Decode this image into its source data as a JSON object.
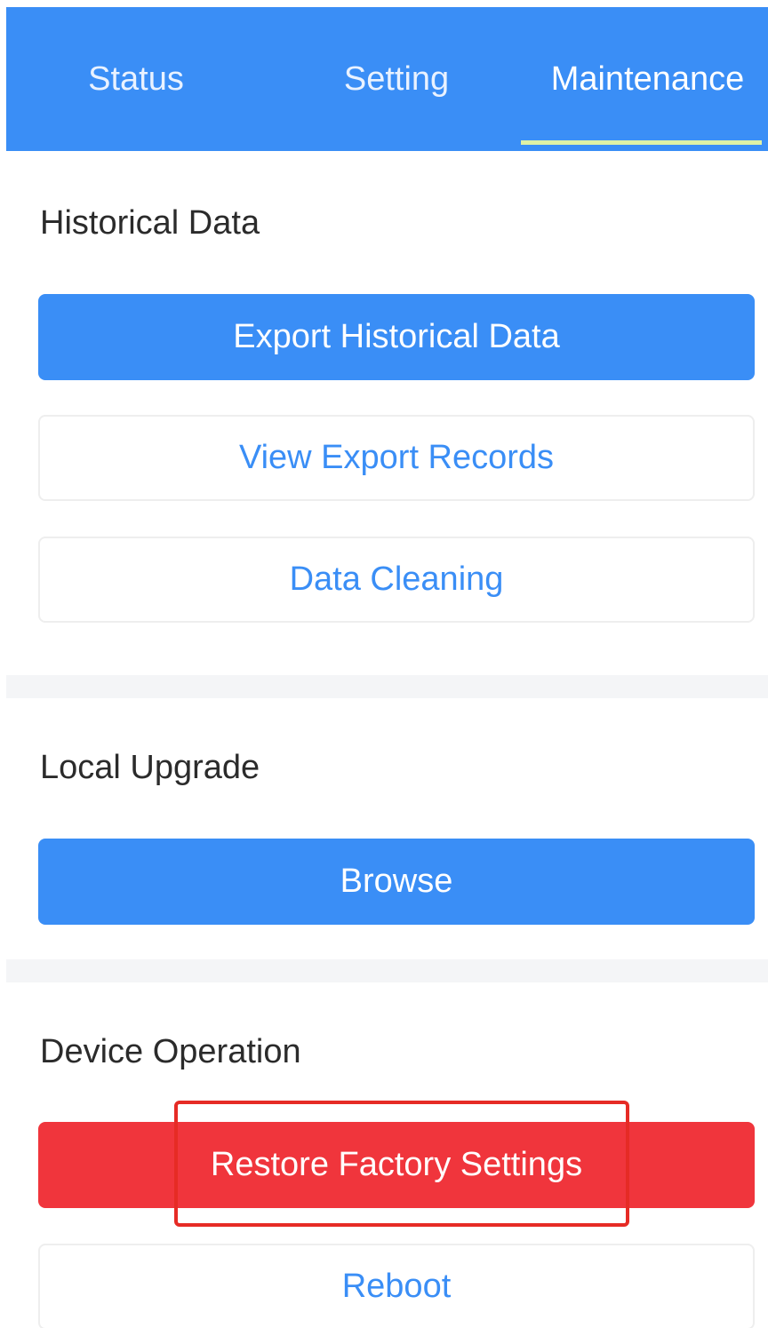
{
  "tabs": {
    "status": "Status",
    "setting": "Setting",
    "maintenance": "Maintenance",
    "active": "maintenance"
  },
  "historical_data": {
    "title": "Historical Data",
    "export_label": "Export Historical Data",
    "view_records_label": "View Export Records",
    "cleaning_label": "Data Cleaning"
  },
  "local_upgrade": {
    "title": "Local Upgrade",
    "browse_label": "Browse"
  },
  "device_operation": {
    "title": "Device Operation",
    "restore_label": "Restore Factory Settings",
    "reboot_label": "Reboot"
  },
  "colors": {
    "primary": "#3a8ef6",
    "danger": "#f0353c",
    "highlight": "#e62b25",
    "tab_indicator": "#dff2a6"
  }
}
